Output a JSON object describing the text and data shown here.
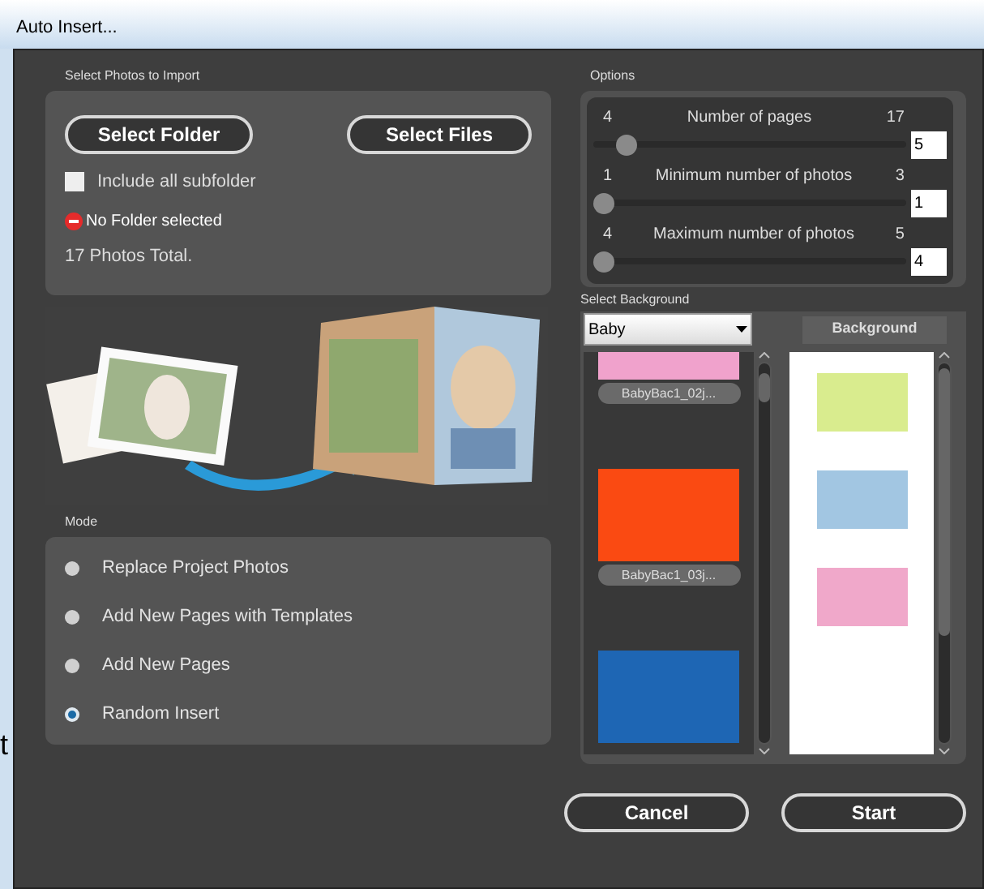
{
  "window": {
    "title": "Auto Insert..."
  },
  "background_text": "t",
  "import": {
    "label": "Select Photos to Import",
    "buttons": [
      "Select Folder",
      "Select Files"
    ],
    "include_subfolder": {
      "label": "Include all subfolder",
      "checked": false
    },
    "status": "No Folder selected",
    "total": "17 Photos Total."
  },
  "mode": {
    "label": "Mode",
    "options": [
      {
        "label": "Replace Project Photos",
        "selected": false
      },
      {
        "label": "Add New Pages with Templates",
        "selected": false
      },
      {
        "label": "Add New Pages",
        "selected": false
      },
      {
        "label": "Random Insert",
        "selected": true
      }
    ]
  },
  "options": {
    "label": "Options",
    "sliders": [
      {
        "min": "4",
        "label": "Number of pages",
        "max": "17",
        "level": 0.08,
        "value": "5"
      },
      {
        "min": "1",
        "label": "Minimum number of photos",
        "max": "3",
        "level": 0,
        "value": "1"
      },
      {
        "min": "4",
        "label": "Maximum number of photos",
        "max": "5",
        "level": 0,
        "value": "4"
      }
    ]
  },
  "background": {
    "label": "Select Background",
    "dropdown": "Baby",
    "header": "Background",
    "thumbnails": [
      {
        "color": "#f0a2cc",
        "name": "BabyBac1_02j..."
      },
      {
        "color": "#fa4a12",
        "name": "BabyBac1_03j..."
      },
      {
        "color": "#1e66b4"
      }
    ],
    "selected": [
      {
        "color": "#d9ec8e"
      },
      {
        "color": "#a2c6e2"
      },
      {
        "color": "#f0a8ca"
      }
    ]
  },
  "buttons": [
    "Cancel",
    "Start"
  ]
}
